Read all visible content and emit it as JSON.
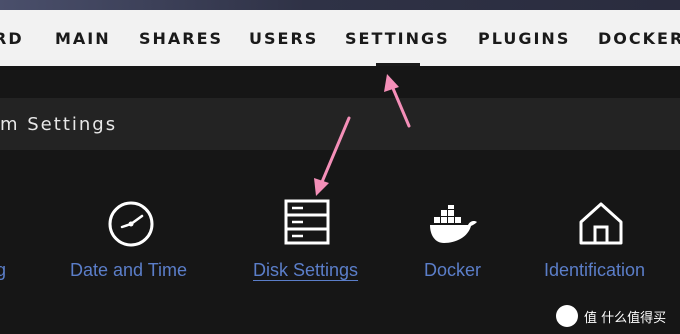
{
  "nav": {
    "items": [
      {
        "label": "RD"
      },
      {
        "label": "MAIN"
      },
      {
        "label": "SHARES"
      },
      {
        "label": "USERS"
      },
      {
        "label": "SETTINGS",
        "active": true
      },
      {
        "label": "PLUGINS"
      },
      {
        "label": "DOCKER"
      }
    ]
  },
  "section": {
    "title": "m Settings"
  },
  "tiles": [
    {
      "label": "g",
      "icon": "clipped-icon"
    },
    {
      "label": "Date and Time",
      "icon": "clock-icon"
    },
    {
      "label": "Disk Settings",
      "icon": "disk-icon",
      "active": true
    },
    {
      "label": "Docker",
      "icon": "docker-whale-icon"
    },
    {
      "label": "Identification",
      "icon": "home-icon"
    }
  ],
  "annotations": {
    "arrow_color": "#f48fb8"
  },
  "watermark": {
    "text": "值 什么值得买"
  },
  "colors": {
    "nav_bg": "#f2f2f2",
    "page_bg": "#161616",
    "section_bg": "#232323",
    "link": "#5b7ec9"
  }
}
